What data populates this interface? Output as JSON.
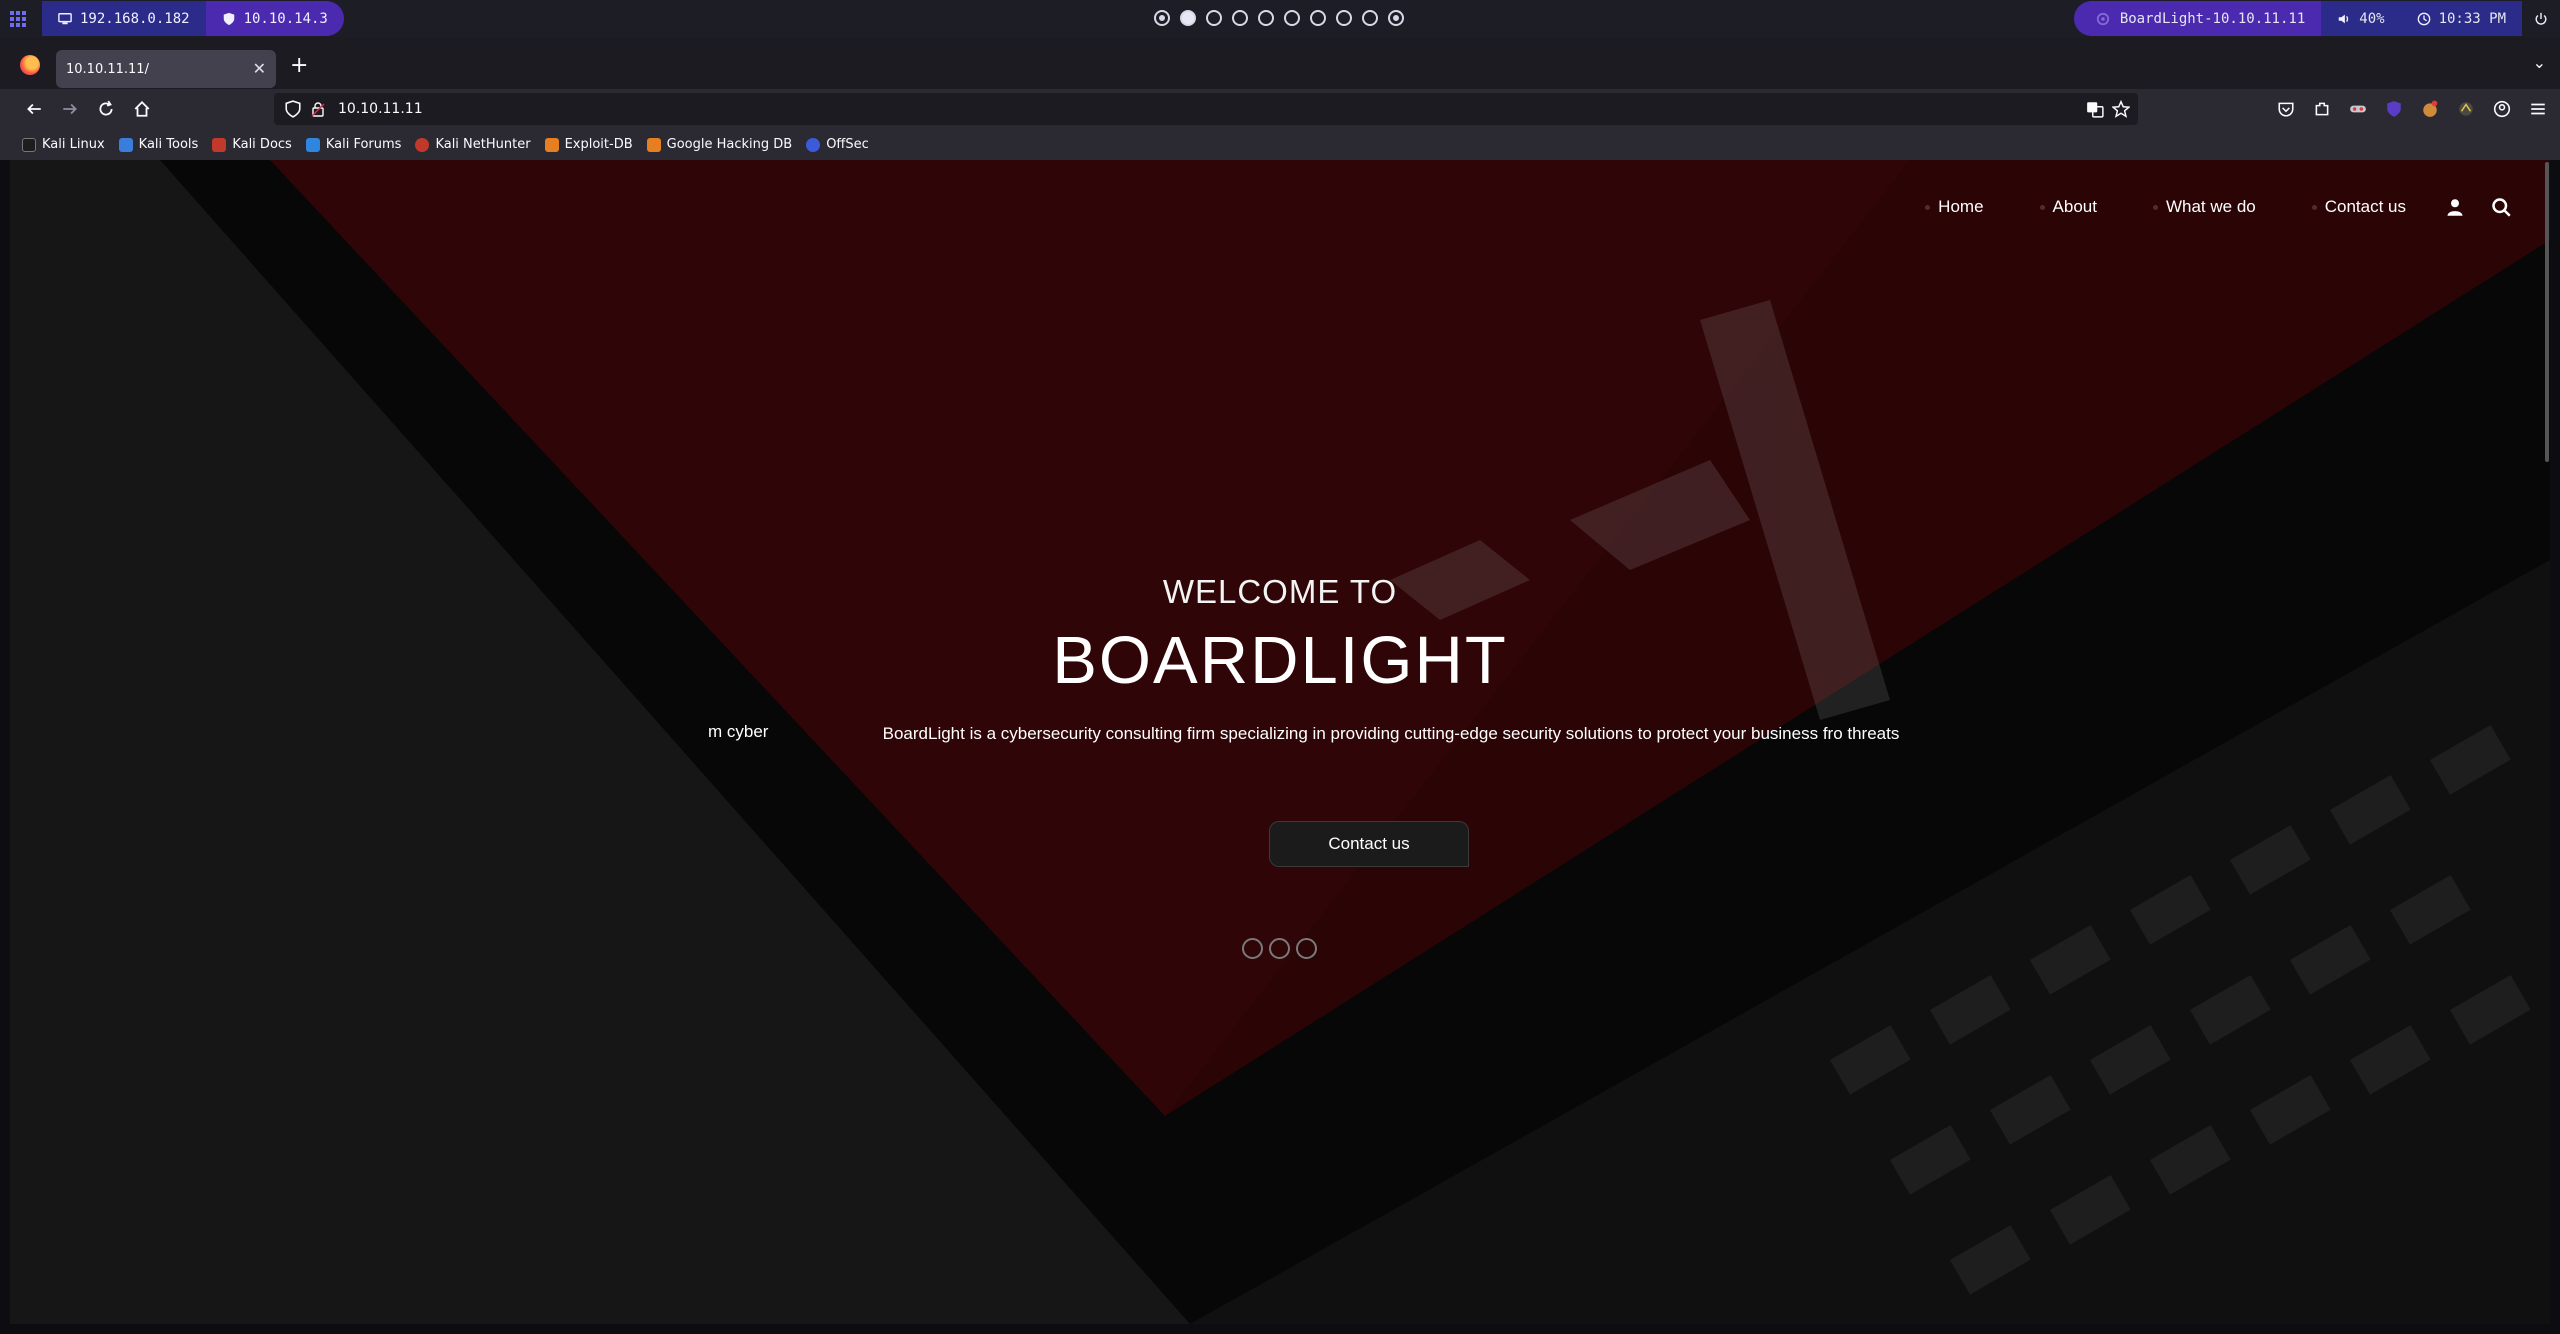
{
  "system_bar": {
    "ip_local": "192.168.0.182",
    "ip_vpn": "10.10.14.3",
    "target": "BoardLight-10.10.11.11",
    "volume": "40%",
    "clock": "10:33 PM",
    "workspaces": 10,
    "active_workspace": 2
  },
  "browser": {
    "tab_title": "10.10.11.11/",
    "url": "10.10.11.11",
    "bookmarks": [
      {
        "label": "Kali Linux",
        "color": "#1d1d1d"
      },
      {
        "label": "Kali Tools",
        "color": "#3b7ddd"
      },
      {
        "label": "Kali Docs",
        "color": "#c0392b"
      },
      {
        "label": "Kali Forums",
        "color": "#2e86de"
      },
      {
        "label": "Kali NetHunter",
        "color": "#c0392b"
      },
      {
        "label": "Exploit-DB",
        "color": "#e67e22"
      },
      {
        "label": "Google Hacking DB",
        "color": "#e67e22"
      },
      {
        "label": "OffSec",
        "color": "#3b5bdb"
      }
    ]
  },
  "site": {
    "nav": [
      {
        "label": "Home"
      },
      {
        "label": "About"
      },
      {
        "label": "What we do"
      },
      {
        "label": "Contact us"
      }
    ],
    "hero": {
      "welcome": "WELCOME TO",
      "brand": "BOARDLIGHT",
      "ghost_text": "m cyber",
      "description": "BoardLight is a cybersecurity consulting firm specializing in providing cutting-edge security solutions to protect your business fro threats",
      "cta": "Contact us",
      "slides": 3
    }
  }
}
